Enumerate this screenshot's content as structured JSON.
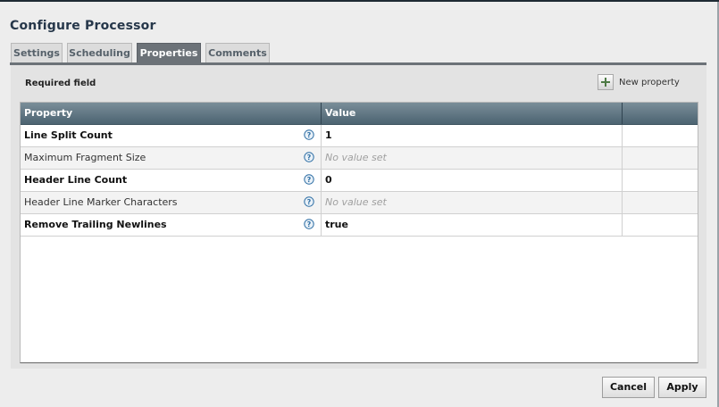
{
  "dialog": {
    "title": "Configure Processor"
  },
  "tabs": [
    {
      "label": "Settings",
      "active": false
    },
    {
      "label": "Scheduling",
      "active": false
    },
    {
      "label": "Properties",
      "active": true
    },
    {
      "label": "Comments",
      "active": false
    }
  ],
  "properties_panel": {
    "required_field_label": "Required field",
    "new_property_label": "New property",
    "new_property_icon": "plus-icon",
    "columns": {
      "property": "Property",
      "value": "Value",
      "actions": ""
    },
    "rows": [
      {
        "name": "Line Split Count",
        "required": true,
        "value": "1",
        "empty": false,
        "help_icon": "help-icon"
      },
      {
        "name": "Maximum Fragment Size",
        "required": false,
        "value": "No value set",
        "empty": true,
        "help_icon": "help-icon"
      },
      {
        "name": "Header Line Count",
        "required": true,
        "value": "0",
        "empty": false,
        "help_icon": "help-icon"
      },
      {
        "name": "Header Line Marker Characters",
        "required": false,
        "value": "No value set",
        "empty": true,
        "help_icon": "help-icon"
      },
      {
        "name": "Remove Trailing Newlines",
        "required": true,
        "value": "true",
        "empty": false,
        "help_icon": "help-icon"
      }
    ]
  },
  "footer": {
    "cancel_label": "Cancel",
    "apply_label": "Apply"
  },
  "colors": {
    "header_gradient_top": "#7a8e99",
    "header_gradient_bottom": "#4c6371",
    "active_tab": "#6c7278",
    "help_icon": "#2f6fa5"
  }
}
